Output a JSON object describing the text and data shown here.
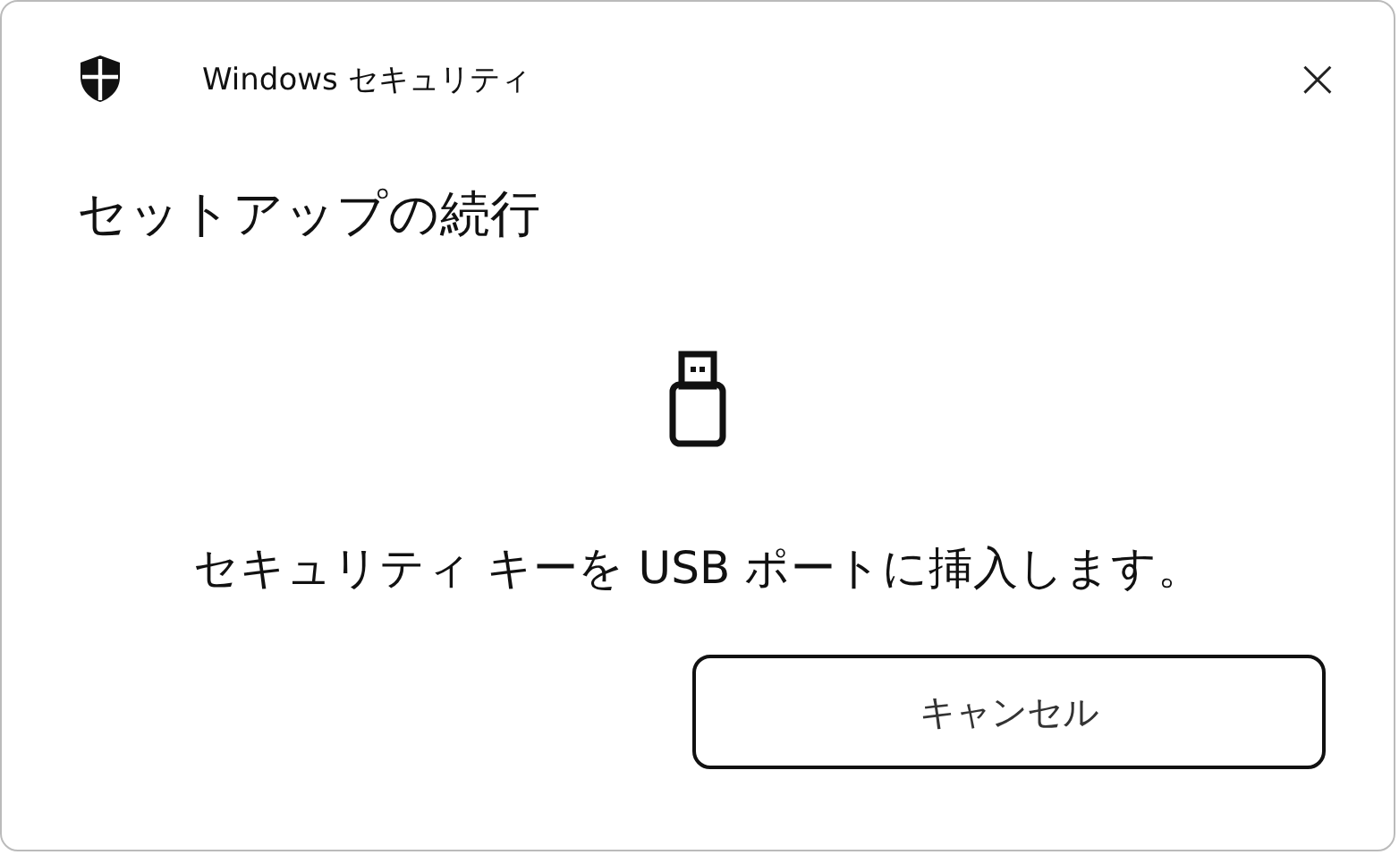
{
  "window": {
    "title": "Windows セキュリティ",
    "close": "×"
  },
  "heading": "セットアップの続行",
  "message": "セキュリティ キーを USB ポートに挿入します。",
  "buttons": [
    "キャンセル"
  ]
}
